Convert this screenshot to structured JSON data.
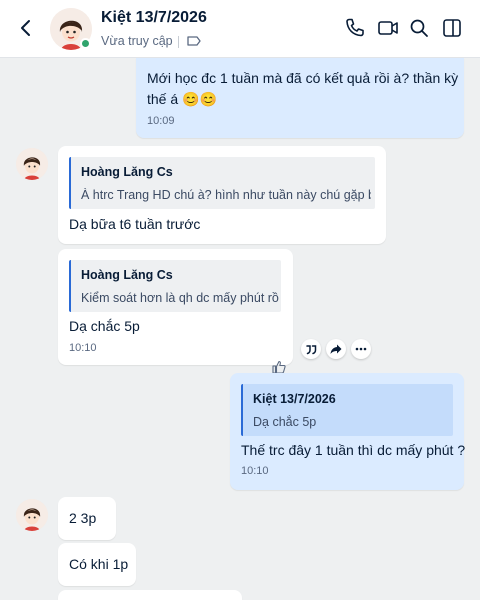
{
  "header": {
    "contact_name": "Kiệt 13/7/2026",
    "status": "Vừa truy cập"
  },
  "messages": [
    {
      "sender": "me",
      "text_lines": [
        "Mới học đc 1 tuần mà đã có kết quả rồi à? thần kỳ",
        "thế á 😊😊"
      ],
      "time": "10:09"
    },
    {
      "sender": "contact",
      "quote": {
        "name": "Hoàng Lăng Cs",
        "text": "À htrc Trang HD chú à? hình như tuần này chú gặp bạn..."
      },
      "text": "Dạ bữa t6 tuần trước"
    },
    {
      "sender": "contact",
      "quote": {
        "name": "Hoàng Lăng Cs",
        "text": "Kiểm soát hơn là qh dc mấy phút rồi ?"
      },
      "text": "Dạ chắc 5p",
      "time": "10:10"
    },
    {
      "sender": "me",
      "quote": {
        "name": "Kiệt 13/7/2026",
        "text": "Dạ chắc 5p"
      },
      "text": "Thế trc đây 1 tuần thì dc mấy phút ?",
      "time": "10:10"
    },
    {
      "sender": "contact",
      "text": "2 3p"
    },
    {
      "sender": "contact",
      "text": "Có khi 1p"
    }
  ],
  "icons": {
    "header": [
      "chevron-left-icon",
      "phone-icon",
      "video-call-icon",
      "search-icon",
      "sidebar-toggle-icon"
    ],
    "message_actions": [
      "quote-icon",
      "share-icon",
      "more-icon",
      "like-icon"
    ]
  },
  "colors": {
    "accent": "#0068ff",
    "my_bubble": "#dbebff",
    "contact_bubble": "#ffffff",
    "background": "#eef0f1",
    "online": "#30a46c"
  }
}
